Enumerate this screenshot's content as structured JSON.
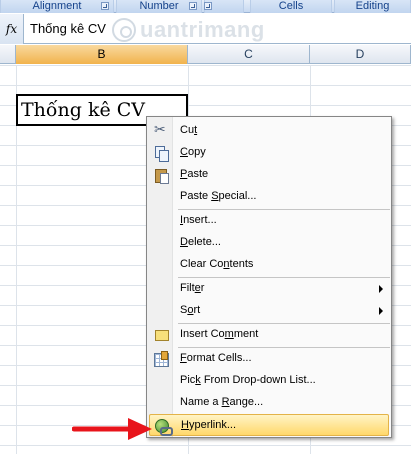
{
  "ribbon": {
    "groups": [
      {
        "label": "Alignment"
      },
      {
        "label": "Number"
      },
      {
        "label": "Cells"
      },
      {
        "label": "Editing"
      }
    ]
  },
  "formula_bar": {
    "fx_label": "fx",
    "value": "Thống kê CV"
  },
  "watermark": {
    "text": "uantrimang"
  },
  "columns": {
    "headers": [
      "B",
      "C",
      "D"
    ]
  },
  "cell": {
    "b_value": "Thống kê CV"
  },
  "menu": {
    "items": [
      {
        "pre": "Cu",
        "acc": "t",
        "post": ""
      },
      {
        "pre": "",
        "acc": "C",
        "post": "opy"
      },
      {
        "pre": "",
        "acc": "P",
        "post": "aste"
      },
      {
        "pre": "Paste ",
        "acc": "S",
        "post": "pecial..."
      },
      {
        "pre": "",
        "acc": "I",
        "post": "nsert..."
      },
      {
        "pre": "",
        "acc": "D",
        "post": "elete..."
      },
      {
        "pre": "Clear Co",
        "acc": "n",
        "post": "tents"
      },
      {
        "pre": "Filt",
        "acc": "e",
        "post": "r"
      },
      {
        "pre": "S",
        "acc": "o",
        "post": "rt"
      },
      {
        "pre": "Insert Co",
        "acc": "m",
        "post": "ment"
      },
      {
        "pre": "",
        "acc": "F",
        "post": "ormat Cells..."
      },
      {
        "pre": "Pic",
        "acc": "k",
        "post": " From Drop-down List..."
      },
      {
        "pre": "Name a ",
        "acc": "R",
        "post": "ange..."
      },
      {
        "pre": "",
        "acc": "H",
        "post": "yperlink..."
      }
    ]
  },
  "colors": {
    "highlight": "#ffd86b",
    "arrow": "#e8141b",
    "selected_column": "#f1b34d"
  }
}
